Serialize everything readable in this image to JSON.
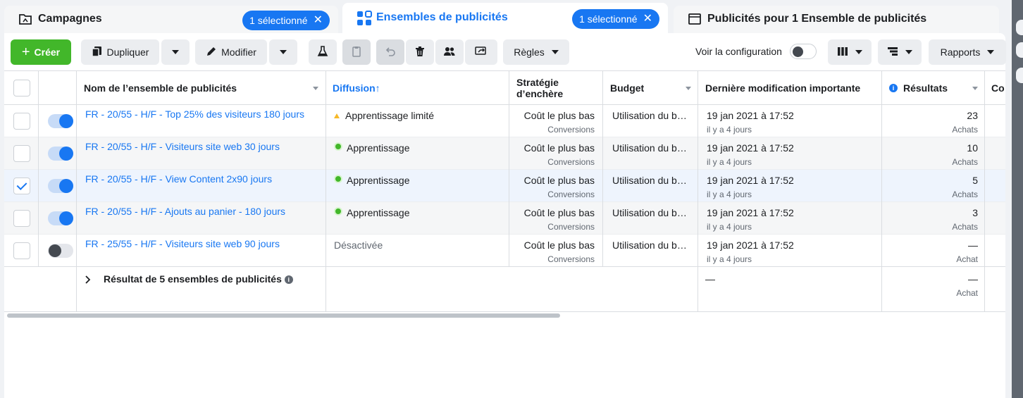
{
  "tabs": [
    {
      "title": "Campagnes",
      "pill": "1 sélectionné"
    },
    {
      "title": "Ensembles de publicités",
      "pill": "1 sélectionné"
    },
    {
      "title": "Publicités pour 1 Ensemble de publicités"
    }
  ],
  "toolbar": {
    "create": "Créer",
    "duplicate": "Dupliquer",
    "edit": "Modifier",
    "rules": "Règles",
    "config": "Voir la configuration",
    "reports": "Rapports"
  },
  "columns": {
    "name": "Nom de l’ensemble de publicités",
    "delivery": "Diffusion",
    "bid_line1": "Stratégie",
    "bid_line2": "d’enchère",
    "budget": "Budget",
    "modified": "Dernière modification importante",
    "results": "Résultats",
    "cut": "Co"
  },
  "rows": [
    {
      "name": "FR - 20/55 - H/F - Top 25% des visiteurs 180 jours",
      "status": "Apprentissage limité",
      "status_kind": "warning",
      "bid": "Coût le plus bas",
      "bid_sub": "Conversions",
      "budget": "Utilisation du b…",
      "date": "19 jan 2021 à 17:52",
      "ago": "il y a 4 jours",
      "result": "23",
      "result_sub": "Achats",
      "on": true,
      "checked": false
    },
    {
      "name": "FR - 20/55 - H/F - Visiteurs site web 30 jours",
      "status": "Apprentissage",
      "status_kind": "active",
      "bid": "Coût le plus bas",
      "bid_sub": "Conversions",
      "budget": "Utilisation du b…",
      "date": "19 jan 2021 à 17:52",
      "ago": "il y a 4 jours",
      "result": "10",
      "result_sub": "Achats",
      "on": true,
      "checked": false
    },
    {
      "name": "FR - 20/55 - H/F - View Content 2x90 jours",
      "status": "Apprentissage",
      "status_kind": "active",
      "bid": "Coût le plus bas",
      "bid_sub": "Conversions",
      "budget": "Utilisation du b…",
      "date": "19 jan 2021 à 17:52",
      "ago": "il y a 4 jours",
      "result": "5",
      "result_sub": "Achats",
      "on": true,
      "checked": true
    },
    {
      "name": "FR - 20/55 - H/F - Ajouts au panier - 180 jours",
      "status": "Apprentissage",
      "status_kind": "active",
      "bid": "Coût le plus bas",
      "bid_sub": "Conversions",
      "budget": "Utilisation du b…",
      "date": "19 jan 2021 à 17:52",
      "ago": "il y a 4 jours",
      "result": "3",
      "result_sub": "Achats",
      "on": true,
      "checked": false
    },
    {
      "name": "FR - 25/55 - H/F - Visiteurs site web 90 jours",
      "status": "Désactivée",
      "status_kind": "off",
      "bid": "Coût le plus bas",
      "bid_sub": "Conversions",
      "budget": "Utilisation du b…",
      "date": "19 jan 2021 à 17:52",
      "ago": "il y a 4 jours",
      "result": "—",
      "result_sub": "Achat",
      "on": false,
      "checked": false
    }
  ],
  "summary": {
    "label": "Résultat de 5 ensembles de publicités",
    "modified": "—",
    "result": "—",
    "result_sub": "Achat"
  },
  "colors": {
    "accent": "#1877f2",
    "create": "#42b72a"
  }
}
